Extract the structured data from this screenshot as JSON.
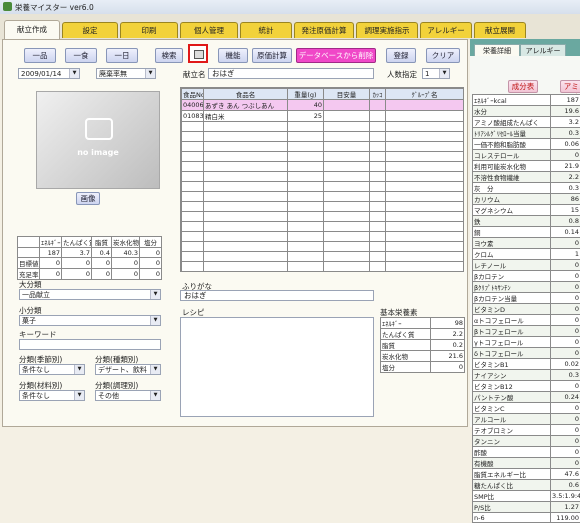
{
  "title": "栄養マイスター ver6.0",
  "tabs": [
    "献立作成",
    "設定",
    "印刷",
    "個人管理",
    "統計",
    "発注原価計算",
    "調理実施指示",
    "アレルギー",
    "献立展開"
  ],
  "toolbar": {
    "ippin": "一品",
    "isshoku": "一食",
    "ichinichi": "一日",
    "kensaku": "検索",
    "kinou": "機能",
    "genka": "原価計算",
    "delete_db": "データベースから削除",
    "touroku": "登録",
    "clear": "クリア"
  },
  "date_value": "2009/01/14",
  "category_value": "廃棄率無",
  "menu_name_label": "献立名",
  "menu_name_value": "おはぎ",
  "persons_label": "人数指定",
  "persons_value": "1",
  "image_caption": "no image",
  "image_button": "画像",
  "food_table": {
    "headers": [
      "食品No",
      "食品名",
      "重量(g)",
      "目安量",
      "ｶｯｺ",
      "ｸﾞﾙｰﾌﾟ名"
    ],
    "rows": [
      [
        "04006",
        "あずき あん つぶしあん",
        "40",
        "",
        "",
        ""
      ],
      [
        "01083",
        "精白米",
        "25",
        "",
        "",
        ""
      ]
    ]
  },
  "nutrition_summary": {
    "headers": [
      "",
      "ｴﾈﾙｷﾞｰ",
      "たんぱく質",
      "脂質",
      "炭水化物",
      "塩分"
    ],
    "rows": [
      [
        "",
        "187",
        "3.7",
        "0.4",
        "40.3",
        "0"
      ],
      [
        "目標値",
        "0",
        "0",
        "0",
        "0",
        "0"
      ],
      [
        "充足率",
        "0",
        "0",
        "0",
        "0",
        "0"
      ]
    ]
  },
  "left_form": {
    "daibunrui_label": "大分類",
    "daibunrui_value": "一品献立",
    "shoubunrui_label": "小分類",
    "shoubunrui_value": "菓子",
    "keyword_label": "キーワード",
    "season_label": "分類(季節別)",
    "season_value": "条件なし",
    "kind_label": "分類(種類別)",
    "kind_value": "デザート、飲料",
    "material_label": "分類(材料別)",
    "material_value": "条件なし",
    "cooking_label": "分類(調理別)",
    "cooking_value": "その他"
  },
  "furigana_label": "ふりがな",
  "furigana_value": "おはぎ",
  "recipe_label": "レシピ",
  "basic_nutrients": {
    "title": "基本栄養素",
    "rows": [
      [
        "ｴﾈﾙｷﾞｰ",
        "98"
      ],
      [
        "たんぱく質",
        "2.2"
      ],
      [
        "脂質",
        "0.2"
      ],
      [
        "炭水化物",
        "21.6"
      ],
      [
        "塩分",
        "0"
      ]
    ]
  },
  "right_panel": {
    "tabs": [
      "栄養詳細",
      "アレルギー"
    ],
    "buttons": [
      "成分表",
      "アミノ酸"
    ],
    "nutrients": [
      [
        "ｴﾈﾙｷﾞｰkcal",
        "187"
      ],
      [
        "水分",
        "19.6"
      ],
      [
        "アミノ酸組成たんぱく",
        "3.2"
      ],
      [
        "ﾄﾘｱｼﾙｸﾞﾘｾﾛｰﾙ当量",
        "0.3"
      ],
      [
        "一価不飽和脂肪酸",
        "0.06"
      ],
      [
        "コレステロール",
        "0"
      ],
      [
        "利用可能炭水化物",
        "21.9"
      ],
      [
        "不溶性食物繊維",
        "2.2"
      ],
      [
        "灰　分",
        "0.3"
      ],
      [
        "カリウム",
        "86"
      ],
      [
        "マグネシウム",
        "15"
      ],
      [
        "鉄",
        "0.8"
      ],
      [
        "銅",
        "0.14"
      ],
      [
        "ヨウ素",
        "0"
      ],
      [
        "クロム",
        "1"
      ],
      [
        "レチノール",
        "0"
      ],
      [
        "βカロテン",
        "0"
      ],
      [
        "βｸﾘﾌﾟﾄｷｻﾝﾁﾝ",
        "0"
      ],
      [
        "βカロテン当量",
        "0"
      ],
      [
        "ビタミンD",
        "0"
      ],
      [
        "αトコフェロール",
        "0"
      ],
      [
        "βトコフェロール",
        "0"
      ],
      [
        "γトコフェロール",
        "0"
      ],
      [
        "δトコフェロール",
        "0"
      ],
      [
        "ビタミンB1",
        "0.02"
      ],
      [
        "ナイアシン",
        "0.3"
      ],
      [
        "ビタミンB12",
        "0"
      ],
      [
        "パントテン酸",
        "0.24"
      ],
      [
        "ビタミンC",
        "0"
      ],
      [
        "アルコール",
        "0"
      ],
      [
        "テオブロミン",
        "0"
      ],
      [
        "タンニン",
        "0"
      ],
      [
        "酢酸",
        "0"
      ],
      [
        "有機酸",
        "0"
      ],
      [
        "脂質エネルギー比",
        "47.6"
      ],
      [
        "糖たんぱく比",
        "0.6"
      ],
      [
        "SMP比",
        "3.5:1.9:4.6"
      ],
      [
        "P/S比",
        "1.27"
      ],
      [
        "n-6",
        "119.00"
      ]
    ]
  }
}
